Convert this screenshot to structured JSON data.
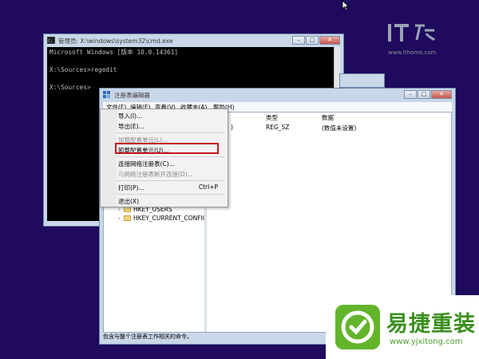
{
  "cmd_window": {
    "title": "管理员: X:\\windows\\system32\\cmd.exe",
    "lines": [
      "Microsoft Windows [版本 10.0.14361]",
      "",
      "X:\\Sources>regedit",
      "",
      "X:\\Sources>"
    ]
  },
  "regedit": {
    "title": "注册表编辑器",
    "menus": [
      "文件(F)",
      "编辑(E)",
      "查看(V)",
      "收藏夹(A)",
      "帮助(H)"
    ],
    "columns": [
      "类型",
      "数据"
    ],
    "row": {
      "name_tail": ")",
      "type": "REG_SZ",
      "data": "(数值未设置)"
    },
    "tree": [
      "HKEY_USERS",
      "HKEY_CURRENT_CONFIG"
    ],
    "status": "包含与整个注册表工作相关的命令。"
  },
  "file_menu": {
    "items": [
      "导入(I)...",
      "导出(E)...",
      "加载配置单元(L)...",
      "卸载配置单元(U)...",
      "连接网络注册表(C)...",
      "与网络注册表断开连接(D)...",
      "打印(P)...",
      "退出(X)"
    ],
    "print_shortcut": "Ctrl+P"
  },
  "watermark": {
    "logo": "IT之家",
    "url": "www.ithome.com"
  },
  "brand": {
    "name": "易捷重装",
    "url": "www.yjxitong.com",
    "color": "#3b8f1e"
  },
  "icons": [
    "window-control-icons",
    "folder-icon",
    "chevron-right-icon",
    "arrow-cursor-icon",
    "brand-logo-icon"
  ]
}
